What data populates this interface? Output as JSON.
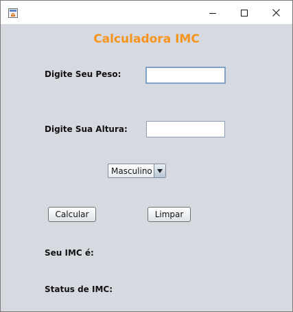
{
  "window": {
    "title_bar": {
      "app_icon": "java-icon",
      "minimize_icon": "minimize-icon",
      "maximize_icon": "maximize-icon",
      "close_icon": "close-icon"
    }
  },
  "form": {
    "title": "Calculadora IMC",
    "peso_label": "Digite Seu Peso:",
    "peso_value": "",
    "altura_label": "Digite Sua Altura:",
    "altura_value": "",
    "sexo_selected": "Masculino",
    "calcular_label": "Calcular",
    "limpar_label": "Limpar",
    "imc_label": "Seu IMC é:",
    "status_label": "Status de IMC:"
  },
  "colors": {
    "title": "#f7941d",
    "window_bg": "#d6d9df"
  }
}
